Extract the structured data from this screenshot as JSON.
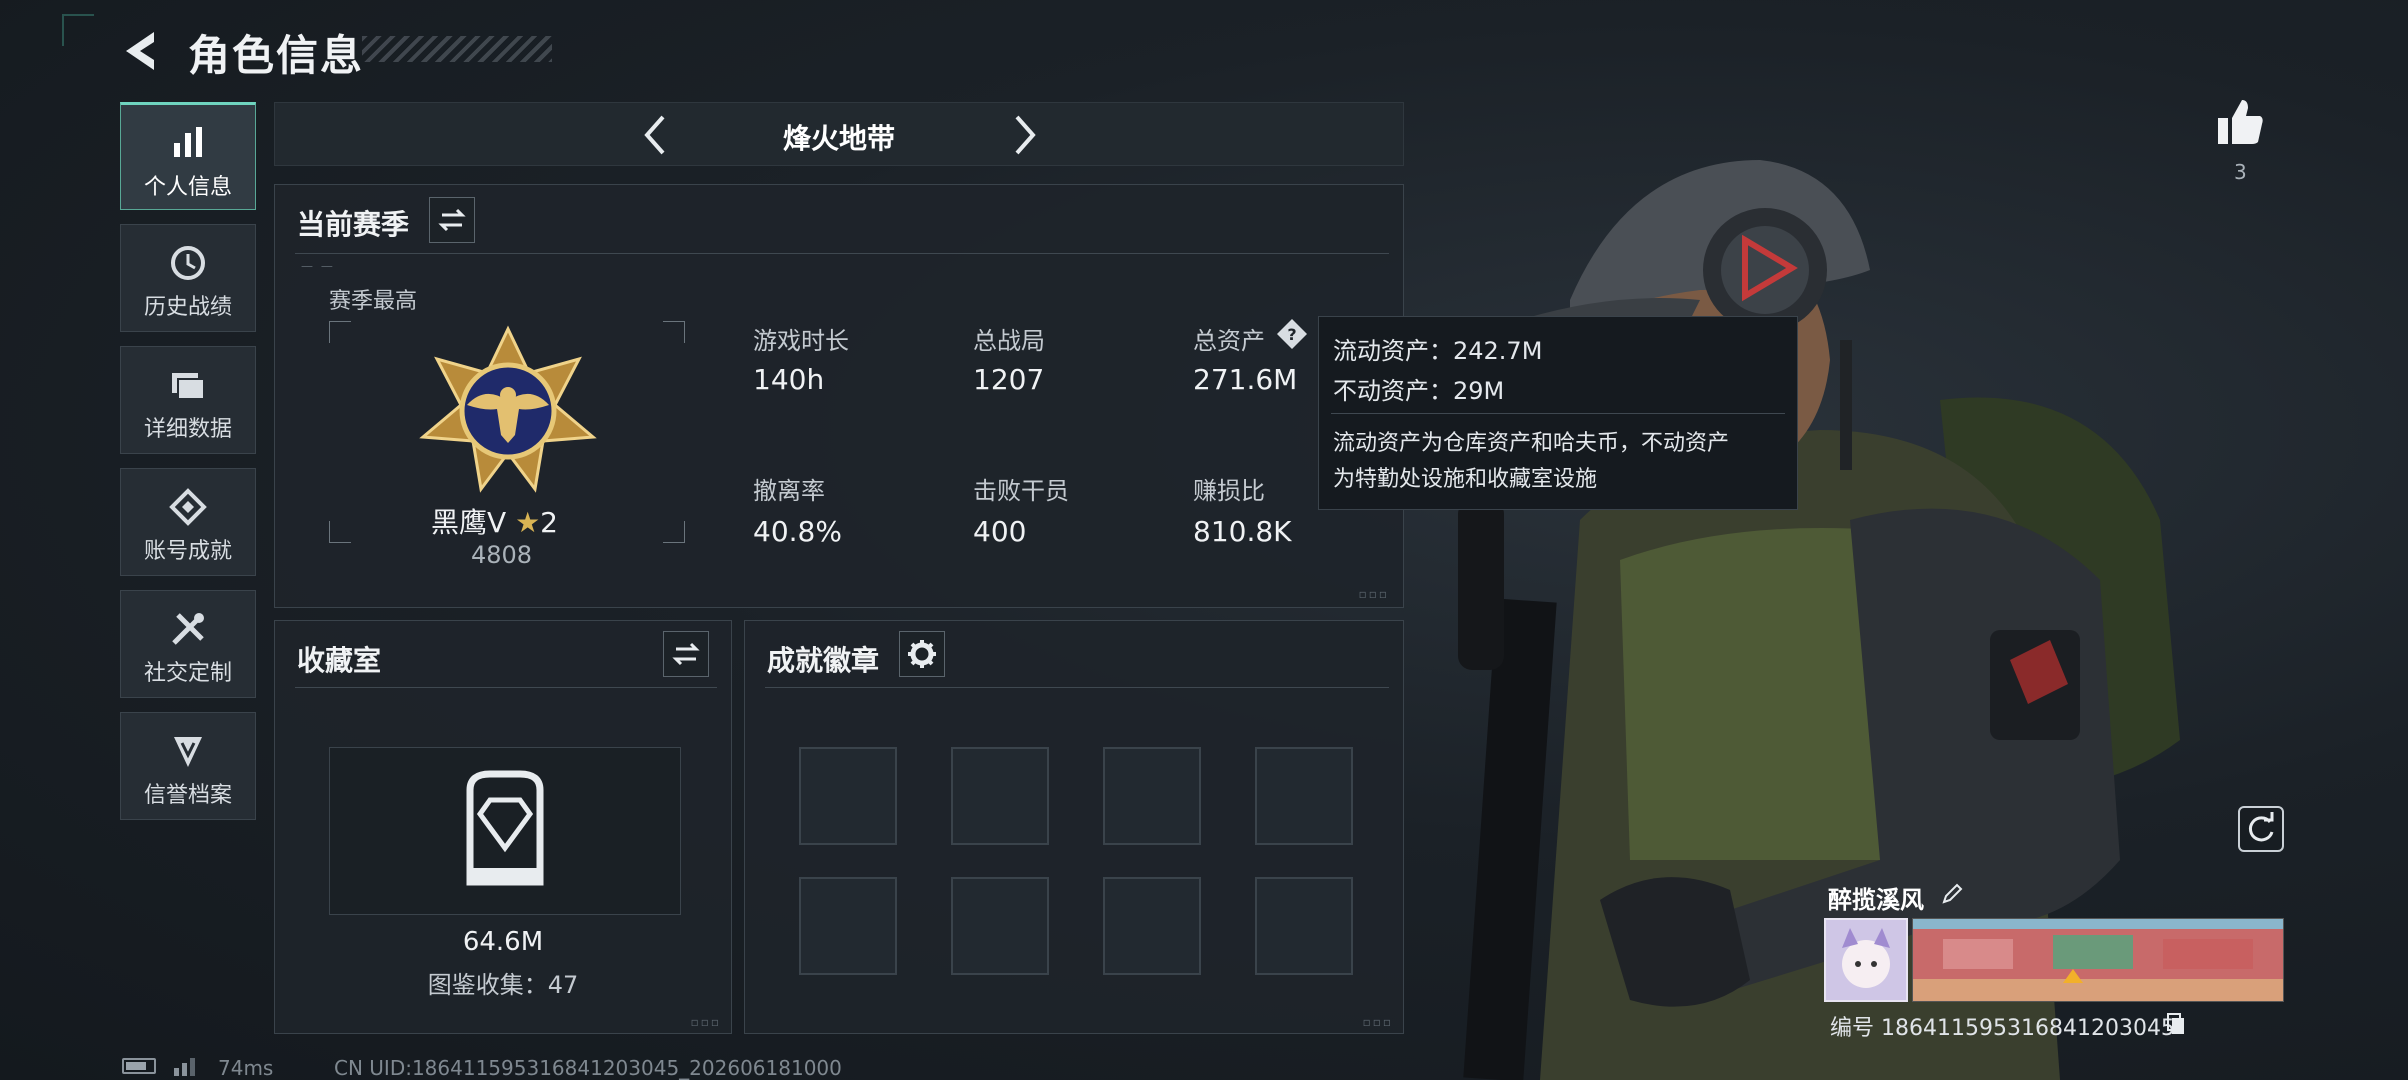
{
  "header": {
    "title": "角色信息"
  },
  "sidebar": {
    "items": [
      {
        "label": "个人信息",
        "icon": "bar-chart-icon",
        "active": true
      },
      {
        "label": "历史战绩",
        "icon": "clock-icon",
        "active": false
      },
      {
        "label": "详细数据",
        "icon": "folder-icon",
        "active": false
      },
      {
        "label": "账号成就",
        "icon": "achievement-icon",
        "active": false
      },
      {
        "label": "社交定制",
        "icon": "tools-icon",
        "active": false
      },
      {
        "label": "信誉档案",
        "icon": "shield-icon",
        "active": false
      }
    ]
  },
  "mode_selector": {
    "label": "烽火地带"
  },
  "season": {
    "title": "当前赛季",
    "best_label": "赛季最高",
    "rank_name": "黑鹰Ⅴ",
    "rank_stars": "2",
    "rank_score": "4808",
    "stats": [
      {
        "label": "游戏时长",
        "value": "140h"
      },
      {
        "label": "总战局",
        "value": "1207"
      },
      {
        "label": "总资产",
        "value": "271.6M"
      },
      {
        "label": "撤离率",
        "value": "40.8%"
      },
      {
        "label": "击败干员",
        "value": "400"
      },
      {
        "label": "赚损比",
        "value": "810.8K"
      }
    ]
  },
  "tooltip": {
    "liquid": "流动资产：242.7M",
    "fixed": "不动资产：29M",
    "desc_line1": "流动资产为仓库资产和哈夫币，不动资产",
    "desc_line2": "为特勤处设施和收藏室设施"
  },
  "collection": {
    "title": "收藏室",
    "value": "64.6M",
    "count_text": "图鉴收集：47"
  },
  "badges": {
    "title": "成就徽章",
    "slots": 8
  },
  "profile": {
    "likes": "3",
    "name": "醉揽溪风",
    "id_text": "编号 18641159531684120304 5",
    "id_display": "编号 186411595316841203045"
  },
  "footer": {
    "ping": "74ms",
    "uid": "CN UID:186411595316841203045_202606181000"
  },
  "colors": {
    "accent": "#6fd4bf",
    "panel_bg": "#1e242a",
    "rank_gold": "#c9a24a"
  }
}
